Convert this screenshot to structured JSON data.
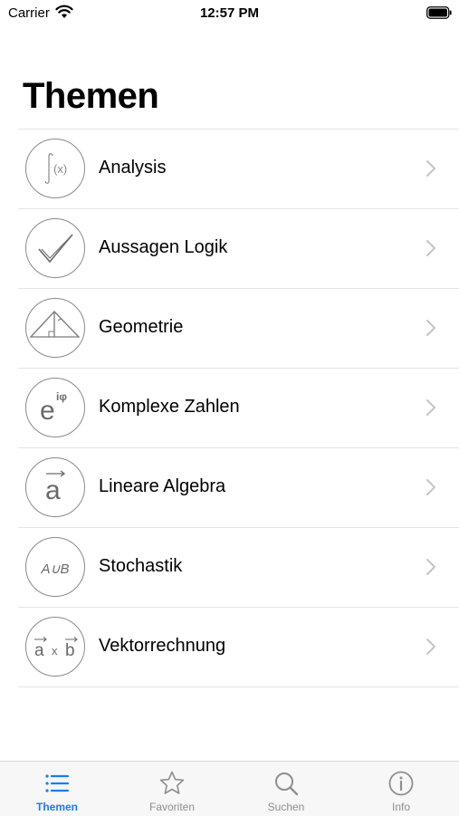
{
  "status_bar": {
    "carrier": "Carrier",
    "time": "12:57 PM"
  },
  "page_title": "Themen",
  "accent_color": "#1a7cf5",
  "topics": [
    {
      "label": "Analysis",
      "icon": "integral-fx-icon",
      "icon_text": "∫(x)"
    },
    {
      "label": "Aussagen Logik",
      "icon": "checkmark-icon"
    },
    {
      "label": "Geometrie",
      "icon": "triangle-icon"
    },
    {
      "label": "Komplexe Zahlen",
      "icon": "euler-exponent-icon",
      "icon_text": "e",
      "icon_sup": "iφ"
    },
    {
      "label": "Lineare Algebra",
      "icon": "vector-a-icon",
      "icon_text": "a"
    },
    {
      "label": "Stochastik",
      "icon": "set-union-icon",
      "icon_text": "A∪B"
    },
    {
      "label": "Vektorrechnung",
      "icon": "cross-product-icon",
      "icon_text": "a x b"
    }
  ],
  "tabs": [
    {
      "label": "Themen",
      "icon": "list-icon",
      "active": true
    },
    {
      "label": "Favoriten",
      "icon": "star-icon",
      "active": false
    },
    {
      "label": "Suchen",
      "icon": "search-icon",
      "active": false
    },
    {
      "label": "Info",
      "icon": "info-icon",
      "active": false
    }
  ]
}
